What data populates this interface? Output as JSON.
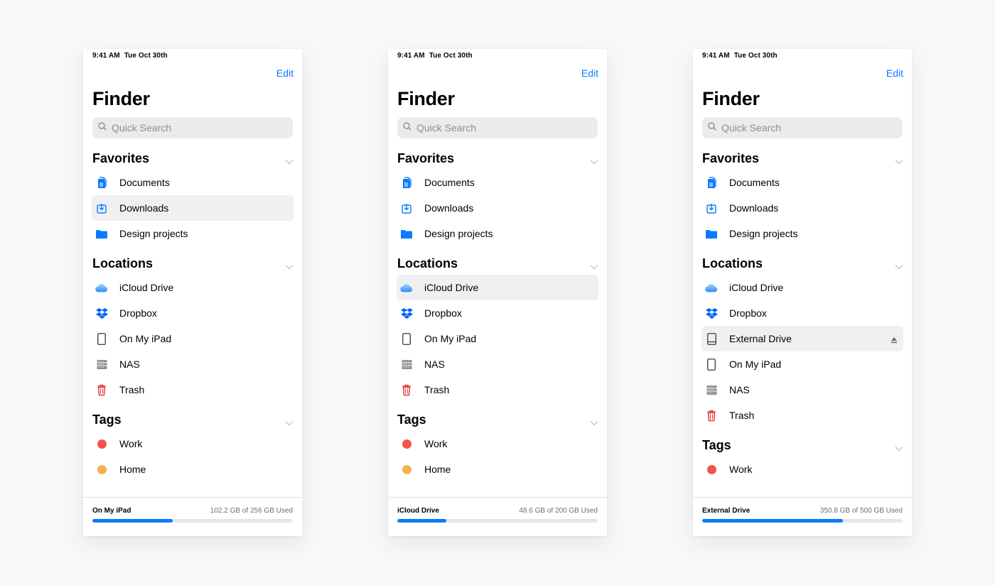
{
  "panels": [
    {
      "status": {
        "time": "9:41 AM",
        "date": "Tue Oct 30th"
      },
      "edit_label": "Edit",
      "title": "Finder",
      "search_placeholder": "Quick Search",
      "favorites": {
        "title": "Favorites",
        "items": [
          {
            "label": "Documents",
            "icon": "documents-icon"
          },
          {
            "label": "Downloads",
            "icon": "downloads-icon",
            "selected": true
          },
          {
            "label": "Design projects",
            "icon": "folder-icon"
          }
        ]
      },
      "locations": {
        "title": "Locations",
        "items": [
          {
            "label": "iCloud Drive",
            "icon": "icloud-icon"
          },
          {
            "label": "Dropbox",
            "icon": "dropbox-icon"
          },
          {
            "label": "On My iPad",
            "icon": "ipad-icon"
          },
          {
            "label": "NAS",
            "icon": "nas-icon"
          },
          {
            "label": "Trash",
            "icon": "trash-icon"
          }
        ]
      },
      "tags": {
        "title": "Tags",
        "items": [
          {
            "label": "Work",
            "color": "#f2544b"
          },
          {
            "label": "Home",
            "color": "#f6b24a"
          }
        ]
      },
      "footer": {
        "name": "On My iPad",
        "used": "102.2 GB of 256 GB Used",
        "fraction": 0.399
      }
    },
    {
      "status": {
        "time": "9:41 AM",
        "date": "Tue Oct 30th"
      },
      "edit_label": "Edit",
      "title": "Finder",
      "search_placeholder": "Quick Search",
      "favorites": {
        "title": "Favorites",
        "items": [
          {
            "label": "Documents",
            "icon": "documents-icon"
          },
          {
            "label": "Downloads",
            "icon": "downloads-icon"
          },
          {
            "label": "Design projects",
            "icon": "folder-icon"
          }
        ]
      },
      "locations": {
        "title": "Locations",
        "items": [
          {
            "label": "iCloud Drive",
            "icon": "icloud-icon",
            "selected": true
          },
          {
            "label": "Dropbox",
            "icon": "dropbox-icon"
          },
          {
            "label": "On My iPad",
            "icon": "ipad-icon"
          },
          {
            "label": "NAS",
            "icon": "nas-icon"
          },
          {
            "label": "Trash",
            "icon": "trash-icon"
          }
        ]
      },
      "tags": {
        "title": "Tags",
        "items": [
          {
            "label": "Work",
            "color": "#f2544b"
          },
          {
            "label": "Home",
            "color": "#f6b24a"
          }
        ]
      },
      "footer": {
        "name": "iCloud Drive",
        "used": "48.6 GB of 200 GB Used",
        "fraction": 0.243
      }
    },
    {
      "status": {
        "time": "9:41 AM",
        "date": "Tue Oct 30th"
      },
      "edit_label": "Edit",
      "title": "Finder",
      "search_placeholder": "Quick Search",
      "favorites": {
        "title": "Favorites",
        "items": [
          {
            "label": "Documents",
            "icon": "documents-icon"
          },
          {
            "label": "Downloads",
            "icon": "downloads-icon"
          },
          {
            "label": "Design projects",
            "icon": "folder-icon"
          }
        ]
      },
      "locations": {
        "title": "Locations",
        "items": [
          {
            "label": "iCloud Drive",
            "icon": "icloud-icon"
          },
          {
            "label": "Dropbox",
            "icon": "dropbox-icon"
          },
          {
            "label": "External Drive",
            "icon": "external-drive-icon",
            "selected": true,
            "eject": true
          },
          {
            "label": "On My iPad",
            "icon": "ipad-icon"
          },
          {
            "label": "NAS",
            "icon": "nas-icon"
          },
          {
            "label": "Trash",
            "icon": "trash-icon"
          }
        ]
      },
      "tags": {
        "title": "Tags",
        "items": [
          {
            "label": "Work",
            "color": "#f2544b"
          }
        ]
      },
      "footer": {
        "name": "External Drive",
        "used": "350.8 GB of 500 GB Used",
        "fraction": 0.702
      }
    }
  ],
  "accent_color": "#0a7aff"
}
